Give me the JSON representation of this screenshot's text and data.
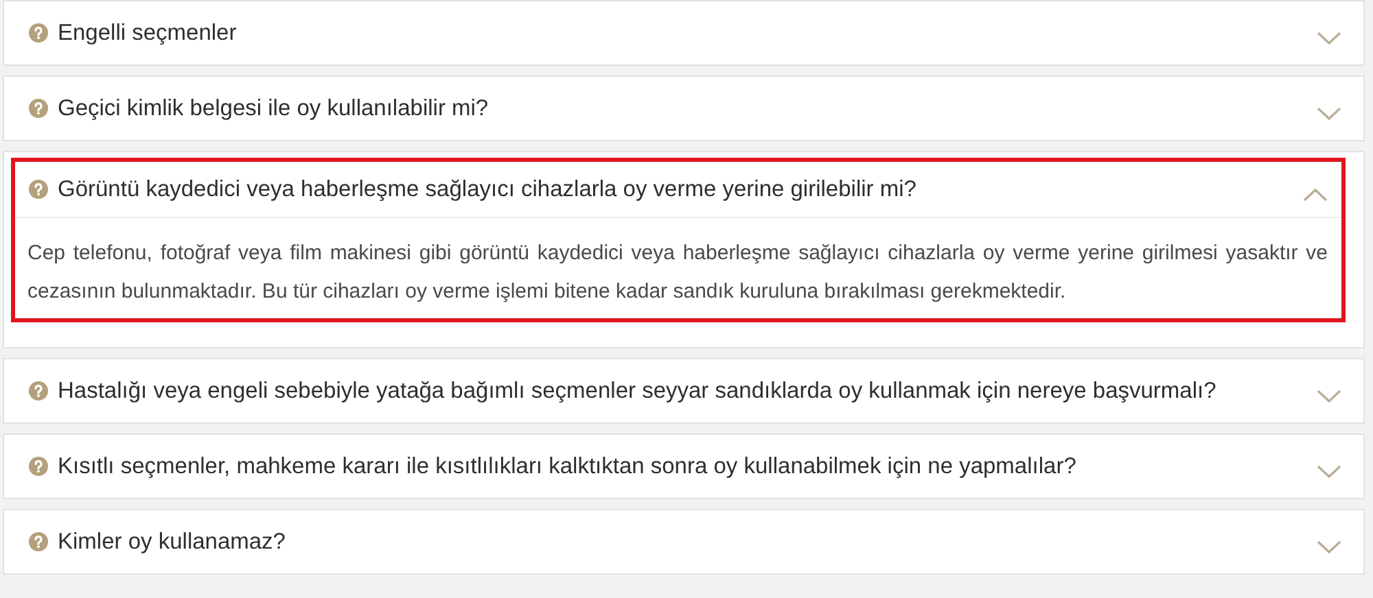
{
  "faq": [
    {
      "question": "Engelli seçmenler",
      "expanded": false,
      "highlighted": false
    },
    {
      "question": "Geçici kimlik belgesi ile oy kullanılabilir mi?",
      "expanded": false,
      "highlighted": false
    },
    {
      "question": "Görüntü kaydedici veya haberleşme sağlayıcı cihazlarla oy verme yerine girilebilir mi?",
      "expanded": true,
      "highlighted": true,
      "answer": "Cep telefonu, fotoğraf veya film makinesi gibi görüntü kaydedici veya haberleşme sağlayıcı cihazlarla oy verme yerine girilmesi yasaktır ve cezasının bulunmaktadır. Bu tür cihazları oy verme işlemi bitene kadar sandık kuruluna bırakılması gerekmektedir."
    },
    {
      "question": "Hastalığı veya engeli sebebiyle yatağa bağımlı seçmenler seyyar sandıklarda oy kullanmak için nereye başvurmalı?",
      "expanded": false,
      "highlighted": false
    },
    {
      "question": "Kısıtlı seçmenler, mahkeme kararı ile kısıtlılıkları kalktıktan sonra oy kullanabilmek için ne yapmalılar?",
      "expanded": false,
      "highlighted": false
    },
    {
      "question": "Kimler oy kullanamaz?",
      "expanded": false,
      "highlighted": false
    }
  ]
}
